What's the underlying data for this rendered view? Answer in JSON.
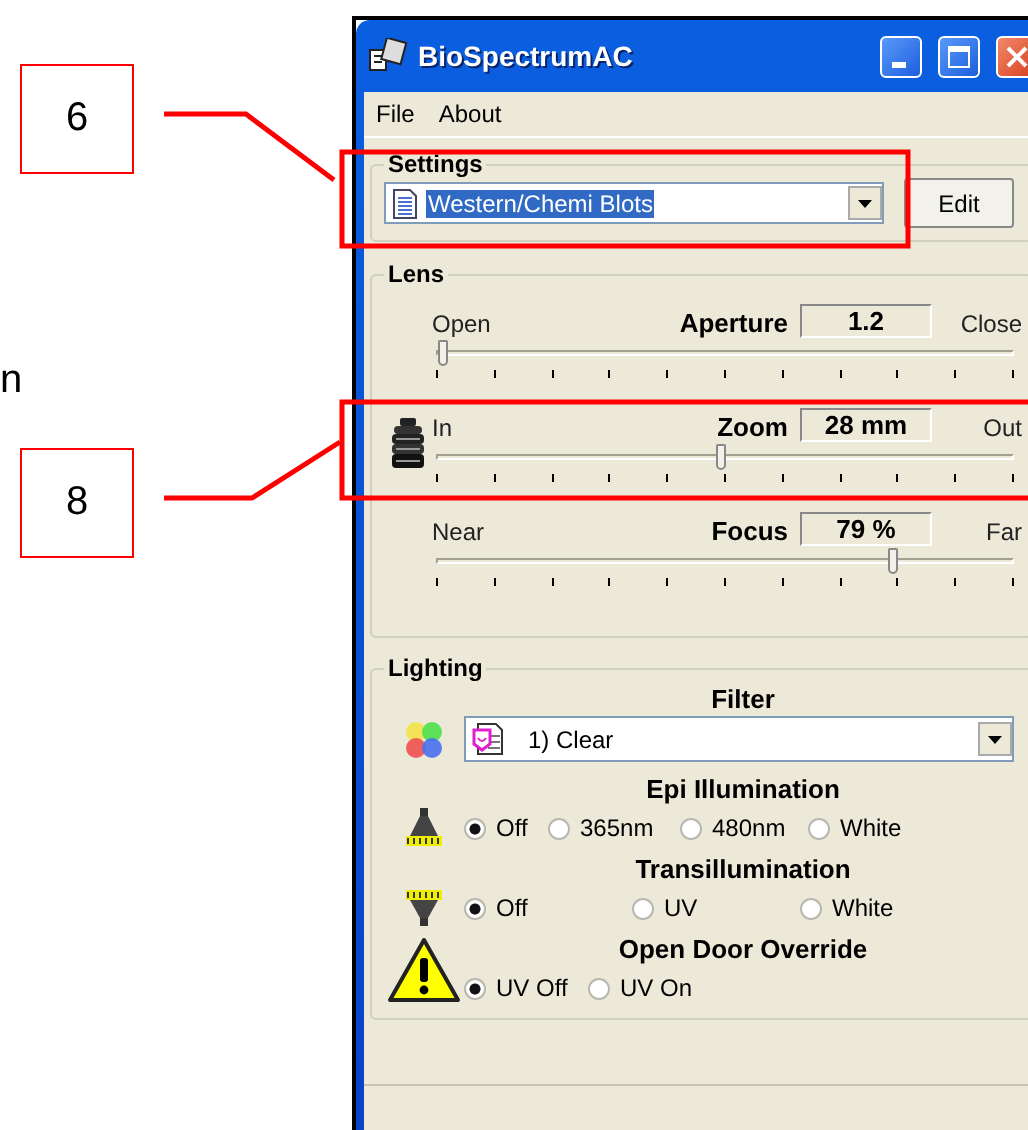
{
  "callouts": [
    {
      "label": "6"
    },
    {
      "label": "8"
    }
  ],
  "cut_text": "n",
  "window": {
    "title": "BioSpectrumAC"
  },
  "menu": [
    "File",
    "About"
  ],
  "settings": {
    "title": "Settings",
    "profile": {
      "value": "Western/Chemi Blots",
      "highlighted": true
    },
    "edit_button": "Edit"
  },
  "lens": {
    "title": "Lens",
    "controls": [
      {
        "kind": "aperture",
        "label": "Aperture",
        "reading": "1.2",
        "min_label": "Open",
        "max_label": "Close",
        "level": 0.01
      },
      {
        "kind": "zoom",
        "label": "Zoom",
        "reading": "28 mm",
        "min_label": "In",
        "max_label": "Out",
        "level": 0.49
      },
      {
        "kind": "focus",
        "label": "Focus",
        "reading": "79 %",
        "min_label": "Near",
        "max_label": "Far",
        "level": 0.79
      }
    ]
  },
  "lighting": {
    "title": "Lighting",
    "filter": {
      "label": "Filter",
      "value": "1) Clear"
    },
    "groups": [
      {
        "kind": "epi",
        "title": "Epi Illumination",
        "options": [
          {
            "label": "Off",
            "selected": true
          },
          {
            "label": "365nm",
            "selected": false
          },
          {
            "label": "480nm",
            "selected": false
          },
          {
            "label": "White",
            "selected": false
          }
        ]
      },
      {
        "kind": "trans",
        "title": "Transillumination",
        "options": [
          {
            "label": "Off",
            "selected": true
          },
          {
            "label": "UV",
            "selected": false
          },
          {
            "label": "White",
            "selected": false
          }
        ]
      },
      {
        "kind": "door",
        "title": "Open Door Override",
        "options": [
          {
            "label": "UV Off",
            "selected": true
          },
          {
            "label": "UV On",
            "selected": false
          }
        ]
      }
    ]
  }
}
